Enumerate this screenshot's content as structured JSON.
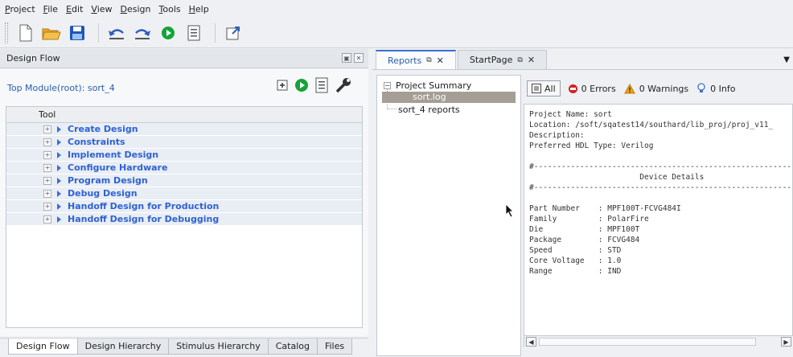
{
  "menubar": [
    "Project",
    "File",
    "Edit",
    "View",
    "Design",
    "Tools",
    "Help"
  ],
  "toolbar": {
    "icons": [
      "new-file-icon",
      "open-folder-icon",
      "save-icon",
      "undo-icon",
      "redo-icon",
      "run-icon",
      "report-icon",
      "resize-icon"
    ]
  },
  "design_flow": {
    "title": "Design Flow",
    "top_module": "Top Module(root): sort_4",
    "tree_header": "Tool",
    "items": [
      "Create Design",
      "Constraints",
      "Implement Design",
      "Configure Hardware",
      "Program Design",
      "Debug Design",
      "Handoff Design for Production",
      "Handoff Design for Debugging"
    ]
  },
  "bottom_tabs": [
    "Design Flow",
    "Design Hierarchy",
    "Stimulus Hierarchy",
    "Catalog",
    "Files"
  ],
  "right_tabs": [
    {
      "label": "Reports",
      "active": true
    },
    {
      "label": "StartPage",
      "active": false
    }
  ],
  "reports_tree": {
    "root": "Project Summary",
    "selected": "sort.log",
    "other": "sort_4 reports"
  },
  "filters": {
    "all": "All",
    "errors": "0 Errors",
    "warnings": "0 Warnings",
    "info": "0 Info"
  },
  "log_lines": [
    "Project Name: sort",
    "Location: /soft/sqatest14/southard/lib_proj/proj_v11_",
    "Description:",
    "Preferred HDL Type: Verilog",
    "",
    "#--------------------------------------------------------",
    "                        Device Details",
    "#--------------------------------------------------------",
    "",
    "Part Number    : MPF100T-FCVG484I",
    "Family         : PolarFire",
    "Die            : MPF100T",
    "Package        : FCVG484",
    "Speed          : STD",
    "Core Voltage   : 1.0",
    "Range          : IND"
  ]
}
